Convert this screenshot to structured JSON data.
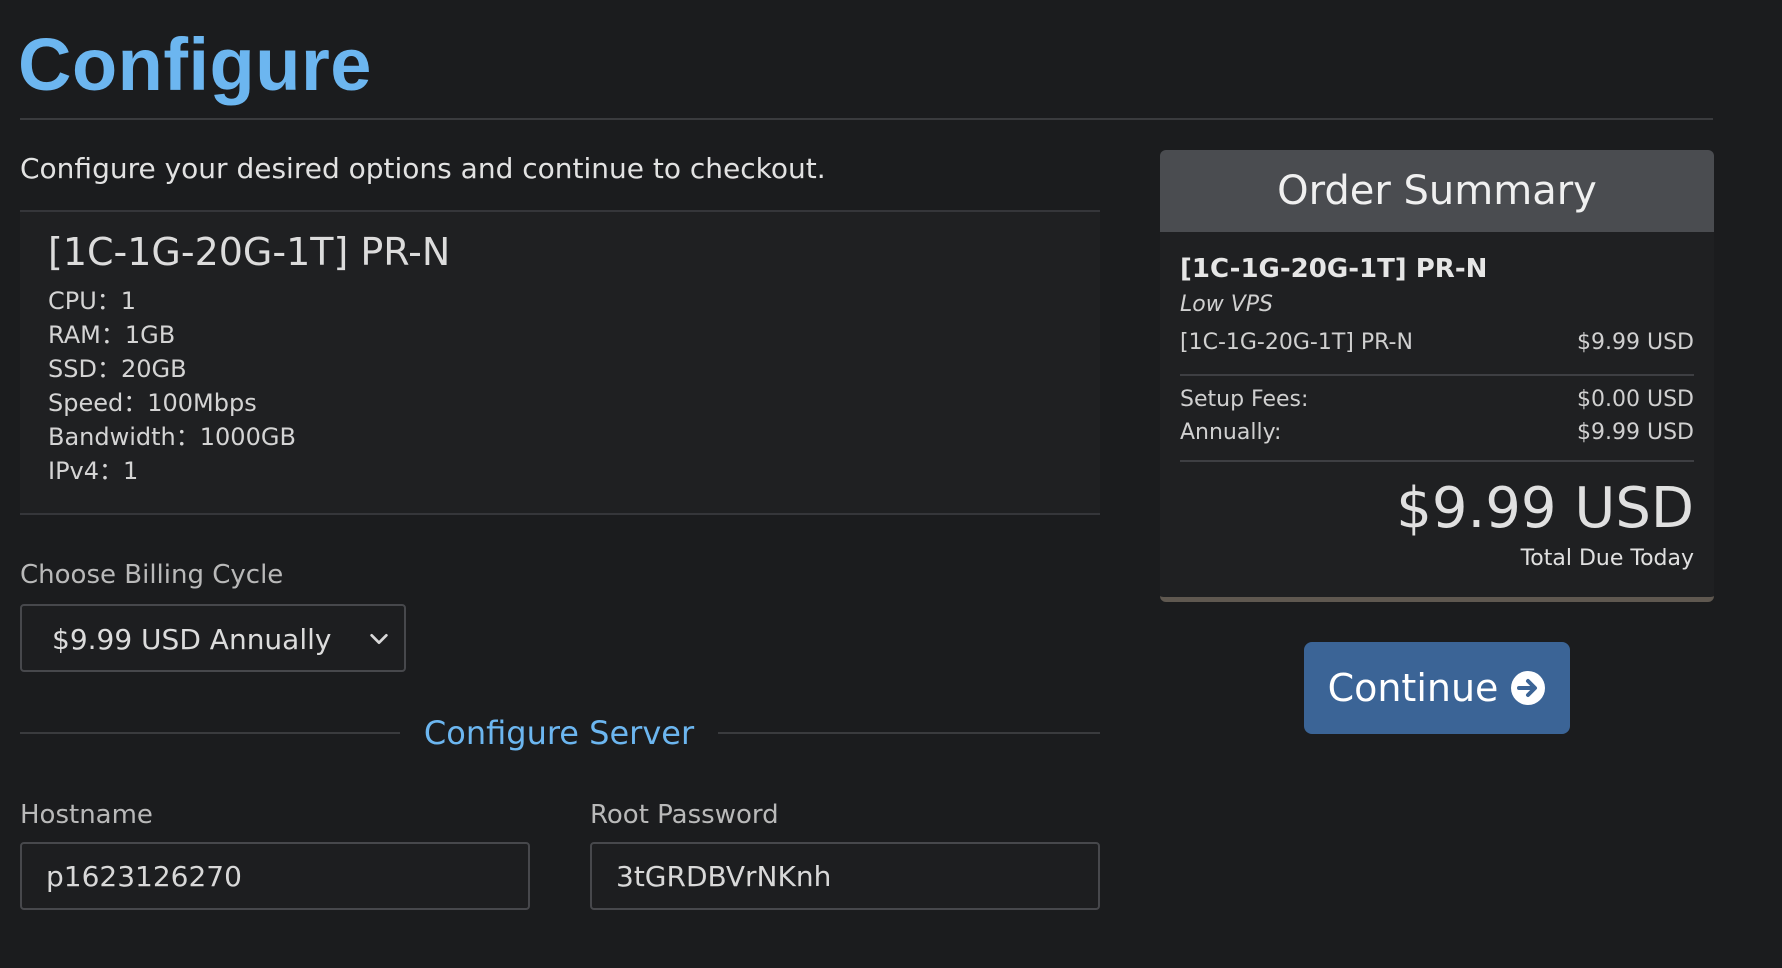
{
  "page": {
    "title": "Configure",
    "intro": "Configure your desired options and continue to checkout."
  },
  "product": {
    "name": "[1C-1G-20G-1T] PR-N",
    "specs": [
      "CPU：1",
      "RAM：1GB",
      "SSD：20GB",
      "Speed：100Mbps",
      "Bandwidth：1000GB",
      "IPv4：1"
    ]
  },
  "billing": {
    "label": "Choose Billing Cycle",
    "selected": "$9.99 USD Annually"
  },
  "configure_server": {
    "title": "Configure Server",
    "hostname_label": "Hostname",
    "hostname_value": "p1623126270",
    "password_label": "Root Password",
    "password_value": "3tGRDBVrNKnh"
  },
  "summary": {
    "title": "Order Summary",
    "product": "[1C-1G-20G-1T] PR-N",
    "group": "Low VPS",
    "line_item": {
      "label": "[1C-1G-20G-1T] PR-N",
      "price": "$9.99 USD"
    },
    "setup_fees": {
      "label": "Setup Fees:",
      "price": "$0.00 USD"
    },
    "annually": {
      "label": "Annually:",
      "price": "$9.99 USD"
    },
    "total": "$9.99 USD",
    "total_label": "Total Due Today"
  },
  "actions": {
    "continue_label": "Continue"
  },
  "colors": {
    "accent": "#6cb6f0",
    "button": "#3b6496",
    "background": "#1b1c1e"
  },
  "icons": {
    "billing_select": "chevron-down-icon",
    "continue": "arrow-circle-right-icon"
  }
}
